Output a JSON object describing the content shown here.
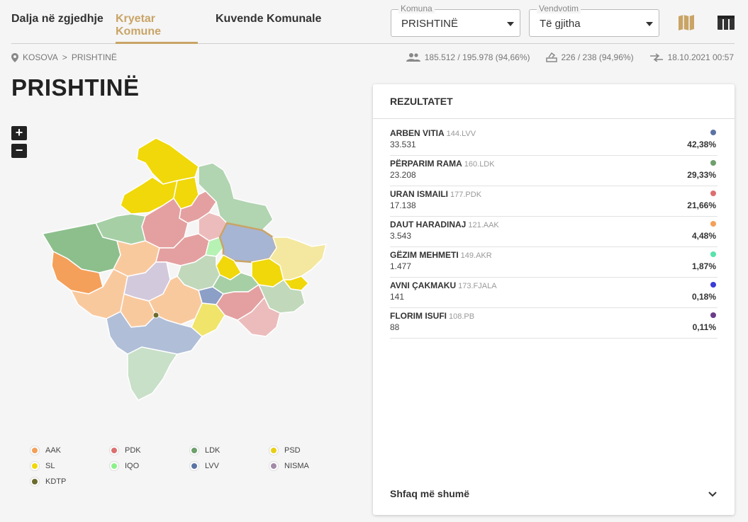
{
  "nav": {
    "tabs": [
      "Dalja në zgjedhje",
      "Kryetar Komune",
      "Kuvende Komunale"
    ],
    "komuna_label": "Komuna",
    "komuna_value": "PRISHTINË",
    "vendvotim_label": "Vendvotim",
    "vendvotim_value": "Të gjitha"
  },
  "breadcrumb": {
    "root": "KOSOVA",
    "sep": ">",
    "current": "PRISHTINË"
  },
  "stats": {
    "voters": "185.512 / 195.978 (94,66%)",
    "stations": "226 / 238 (94,96%)",
    "updated": "18.10.2021 00:57"
  },
  "page": {
    "title": "PRISHTINË"
  },
  "zoom": {
    "in": "+",
    "out": "−"
  },
  "panel": {
    "title": "REZULTATET",
    "more": "Shfaq më shumë",
    "rows": [
      {
        "name": "ARBEN VITIA",
        "code": "144.LVV",
        "votes": "33.531",
        "pct": "42,38%",
        "color": "#5b73a4"
      },
      {
        "name": "PËRPARIM RAMA",
        "code": "160.LDK",
        "votes": "23.208",
        "pct": "29,33%",
        "color": "#6e9f6c"
      },
      {
        "name": "URAN ISMAILI",
        "code": "177.PDK",
        "votes": "17.138",
        "pct": "21,66%",
        "color": "#dc6f6f"
      },
      {
        "name": "DAUT HARADINAJ",
        "code": "121.AAK",
        "votes": "3.543",
        "pct": "4,48%",
        "color": "#f4a05a"
      },
      {
        "name": "GËZIM MEHMETI",
        "code": "149.AKR",
        "votes": "1.477",
        "pct": "1,87%",
        "color": "#57e3a9"
      },
      {
        "name": "AVNI ÇAKMAKU",
        "code": "173.FJALA",
        "votes": "141",
        "pct": "0,18%",
        "color": "#3a3bd8"
      },
      {
        "name": "FLORIM ISUFI",
        "code": "108.PB",
        "votes": "88",
        "pct": "0,11%",
        "color": "#6a3c8a"
      }
    ]
  },
  "legend": [
    {
      "label": "AAK",
      "color": "#f4a05a"
    },
    {
      "label": "PDK",
      "color": "#dc6f6f"
    },
    {
      "label": "LDK",
      "color": "#6e9f6c"
    },
    {
      "label": "PSD",
      "color": "#e8cf14"
    },
    {
      "label": "SL",
      "color": "#f0d80a"
    },
    {
      "label": "IQO",
      "color": "#8cf08a"
    },
    {
      "label": "LVV",
      "color": "#5b73a4"
    },
    {
      "label": "NISMA",
      "color": "#a38aa8"
    },
    {
      "label": "KDTP",
      "color": "#6b6b2e"
    }
  ]
}
